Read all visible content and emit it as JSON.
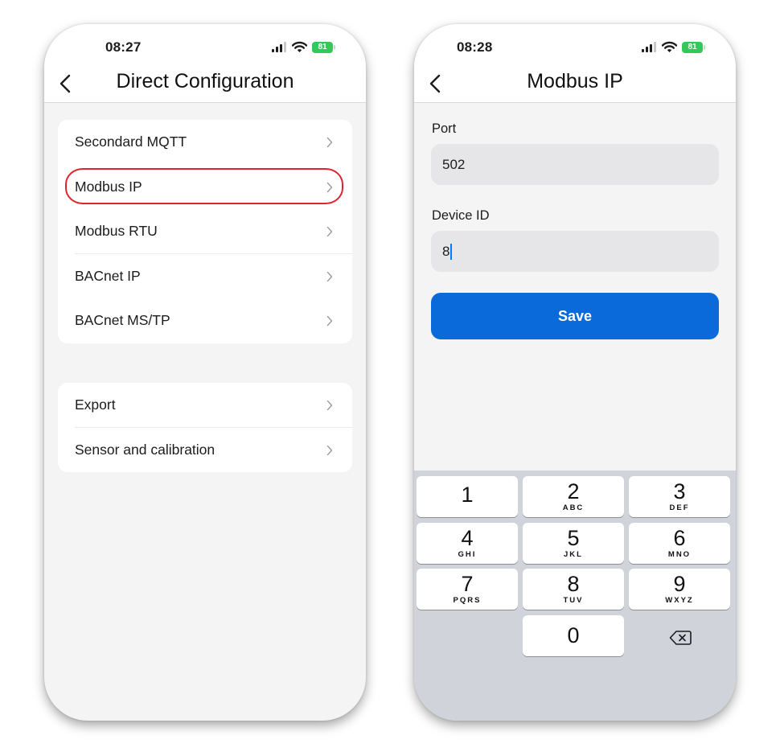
{
  "left_screen": {
    "status": {
      "time": "08:27",
      "battery": "81"
    },
    "title": "Direct Configuration",
    "group1": [
      {
        "label": "Secondard MQTT"
      },
      {
        "label": "Modbus IP"
      },
      {
        "label": "Modbus RTU"
      },
      {
        "label": "BACnet IP"
      },
      {
        "label": "BACnet MS/TP"
      }
    ],
    "group2": [
      {
        "label": "Export"
      },
      {
        "label": "Sensor and calibration"
      }
    ]
  },
  "right_screen": {
    "status": {
      "time": "08:28",
      "battery": "81"
    },
    "title": "Modbus IP",
    "port": {
      "label": "Port",
      "value": "502"
    },
    "device_id": {
      "label": "Device ID",
      "value": "8"
    },
    "save_label": "Save",
    "keypad": [
      {
        "digit": "1",
        "letters": ""
      },
      {
        "digit": "2",
        "letters": "ABC"
      },
      {
        "digit": "3",
        "letters": "DEF"
      },
      {
        "digit": "4",
        "letters": "GHI"
      },
      {
        "digit": "5",
        "letters": "JKL"
      },
      {
        "digit": "6",
        "letters": "MNO"
      },
      {
        "digit": "7",
        "letters": "PQRS"
      },
      {
        "digit": "8",
        "letters": "TUV"
      },
      {
        "digit": "9",
        "letters": "WXYZ"
      },
      {
        "digit": "0",
        "letters": ""
      }
    ]
  },
  "colors": {
    "highlight": "#e0242f",
    "primary": "#0a6ad9",
    "battery": "#34c759",
    "background": "#f4f4f5"
  },
  "icons": [
    "back-chevron-icon",
    "chevron-right-icon",
    "signal-icon",
    "wifi-icon",
    "battery-icon",
    "delete-key-icon"
  ]
}
